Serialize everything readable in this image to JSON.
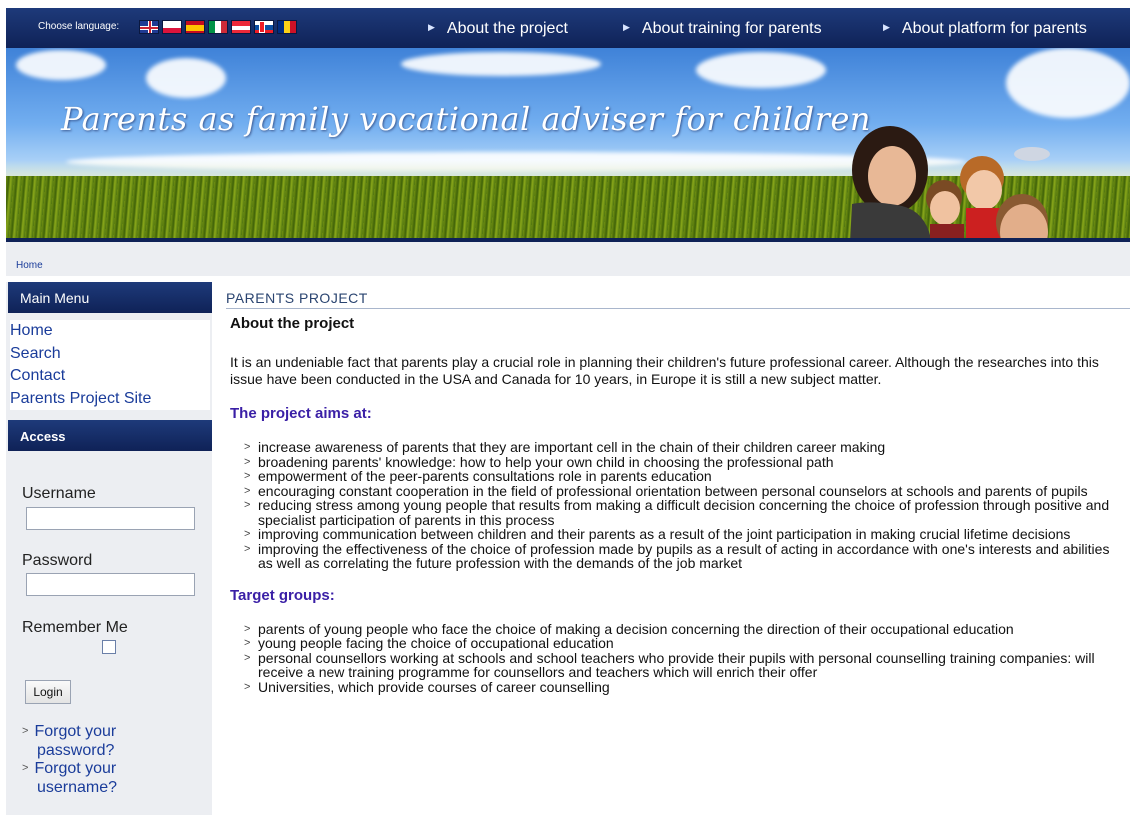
{
  "topbar": {
    "language_label": "Choose language:",
    "flags": [
      "gb-flag",
      "pl-flag",
      "es-flag",
      "it-flag",
      "at-flag",
      "sk-flag",
      "ro-flag"
    ],
    "nav": [
      "About the project",
      "About training for parents",
      "About platform for parents"
    ]
  },
  "banner": {
    "title": "Parents as family vocational adviser for children"
  },
  "breadcrumb": "Home",
  "sidebar": {
    "menu_title": "Main Menu",
    "menu_items": [
      "Home",
      "Search",
      "Contact",
      "Parents Project Site"
    ],
    "access_title": "Access",
    "username_label": "Username",
    "username_value": "",
    "password_label": "Password",
    "password_value": "",
    "remember_label": "Remember Me",
    "remember_checked": false,
    "login_label": "Login",
    "forgot_password": [
      "Forgot your",
      "password?"
    ],
    "forgot_username": [
      "Forgot your",
      "username?"
    ]
  },
  "main": {
    "section_title": "PARENTS PROJECT",
    "page_title": "About the project",
    "intro": "It is an undeniable fact that parents play a crucial role in planning their children's future professional career. Although the researches into this issue have been conducted in the USA and Canada for 10 years, in Europe it is still a new subject matter.",
    "aims_heading": "The project aims at:",
    "aims": [
      "increase awareness of parents that they are important cell in the chain of their children career making",
      "broadening parents' knowledge: how to help your own child in choosing the professional path",
      "empowerment of the peer-parents consultations role  in parents education",
      "encouraging constant cooperation in the field of professional orientation between personal counselors at  schools and parents of pupils",
      "reducing stress among young people that results from making a difficult decision concerning the choice of profession through positive and specialist participation of parents in this process",
      "improving communication between children and their parents as a result of the joint participation in making crucial lifetime decisions",
      "improving the effectiveness of the choice of profession made by pupils as a result of acting in accordance with one's interests and abilities as well as correlating the future profession with the demands of the job market"
    ],
    "target_heading": "Target groups:",
    "targets": [
      "parents of young people who face the choice of making a decision concerning the direction of their occupational education",
      "young people facing the choice of occupational education",
      "personal counsellors working at schools and school teachers who provide their pupils with personal counselling training companies: will receive a new training programme for counsellors and teachers which will enrich their offer",
      "Universities, which provide courses of career counselling"
    ]
  }
}
